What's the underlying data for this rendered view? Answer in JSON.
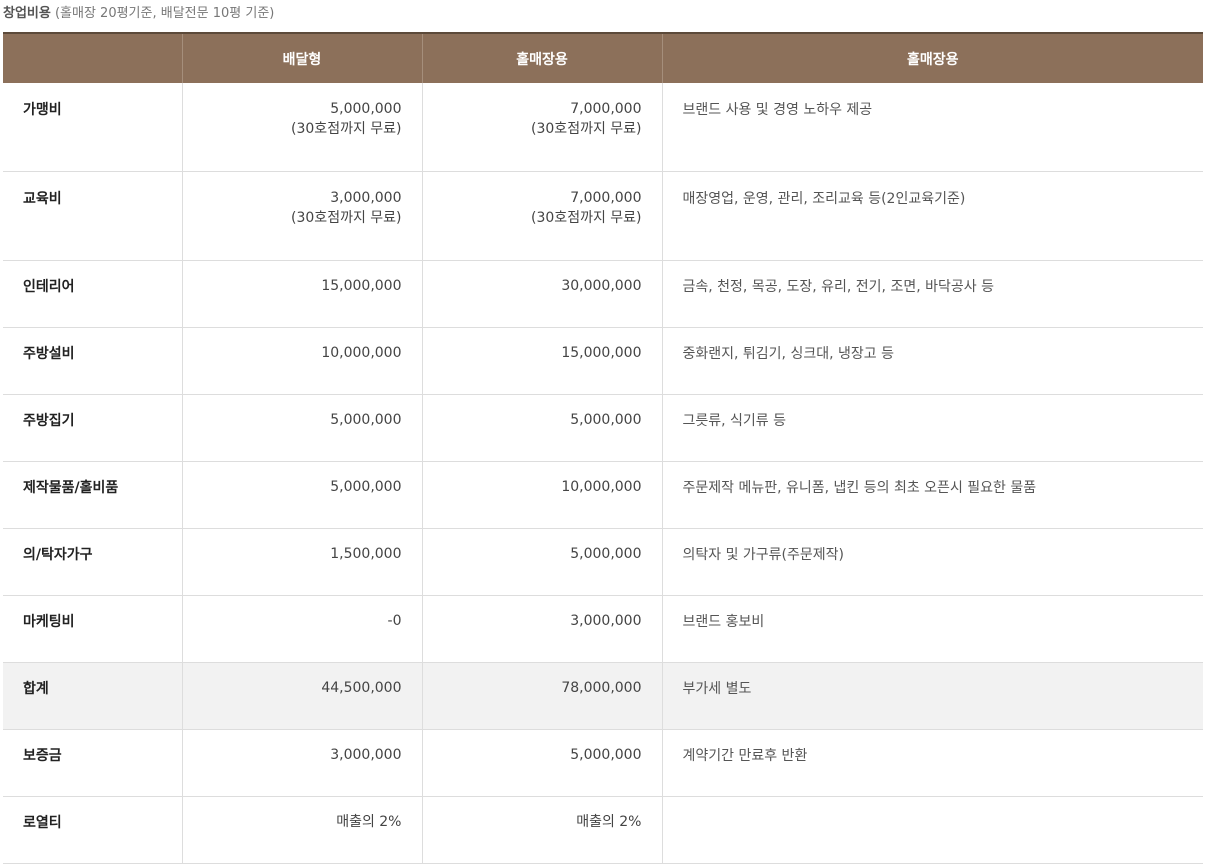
{
  "caption": {
    "title": "창업비용",
    "subtitle": " (홀매장 20평기준, 배달전문 10평 기준)"
  },
  "colors": {
    "header_bg": "#8c705a",
    "header_text": "#ffffff",
    "total_row_bg": "#f2f2f2",
    "border": "#dddddd"
  },
  "table": {
    "headers": [
      "",
      "배달형",
      "홀매장용",
      "홀매장용"
    ],
    "rows": [
      {
        "item": "가맹비",
        "delivery": "5,000,000",
        "delivery_note": "(30호점까지 무료)",
        "hall": "7,000,000",
        "hall_note": "(30호점까지 무료)",
        "desc": "브랜드 사용 및 경영 노하우 제공"
      },
      {
        "item": "교육비",
        "delivery": "3,000,000",
        "delivery_note": "(30호점까지 무료)",
        "hall": "7,000,000",
        "hall_note": "(30호점까지 무료)",
        "desc": "매장영업, 운영, 관리, 조리교육 등(2인교육기준)"
      },
      {
        "item": "인테리어",
        "delivery": "15,000,000",
        "hall": "30,000,000",
        "desc": "금속, 천정, 목공, 도장, 유리, 전기, 조면, 바닥공사 등"
      },
      {
        "item": "주방설비",
        "delivery": "10,000,000",
        "hall": "15,000,000",
        "desc": "중화랜지, 튀김기, 싱크대, 냉장고 등"
      },
      {
        "item": "주방집기",
        "delivery": "5,000,000",
        "hall": "5,000,000",
        "desc": "그릇류, 식기류 등"
      },
      {
        "item": "제작물품/홀비품",
        "delivery": "5,000,000",
        "hall": "10,000,000",
        "desc": "주문제작 메뉴판, 유니폼, 냅킨 등의 최초 오픈시 필요한 물품"
      },
      {
        "item": "의/탁자가구",
        "delivery": "1,500,000",
        "hall": "5,000,000",
        "desc": "의탁자 및 가구류(주문제작)"
      },
      {
        "item": "마케팅비",
        "delivery": "-0",
        "hall": "3,000,000",
        "desc": "브랜드 홍보비"
      },
      {
        "item": "합계",
        "delivery": "44,500,000",
        "hall": "78,000,000",
        "desc": "부가세 별도"
      },
      {
        "item": "보증금",
        "delivery": "3,000,000",
        "hall": "5,000,000",
        "desc": "계약기간 만료후 반환"
      },
      {
        "item": "로열티",
        "delivery": "매출의 2%",
        "hall": "매출의 2%",
        "desc": ""
      }
    ]
  }
}
